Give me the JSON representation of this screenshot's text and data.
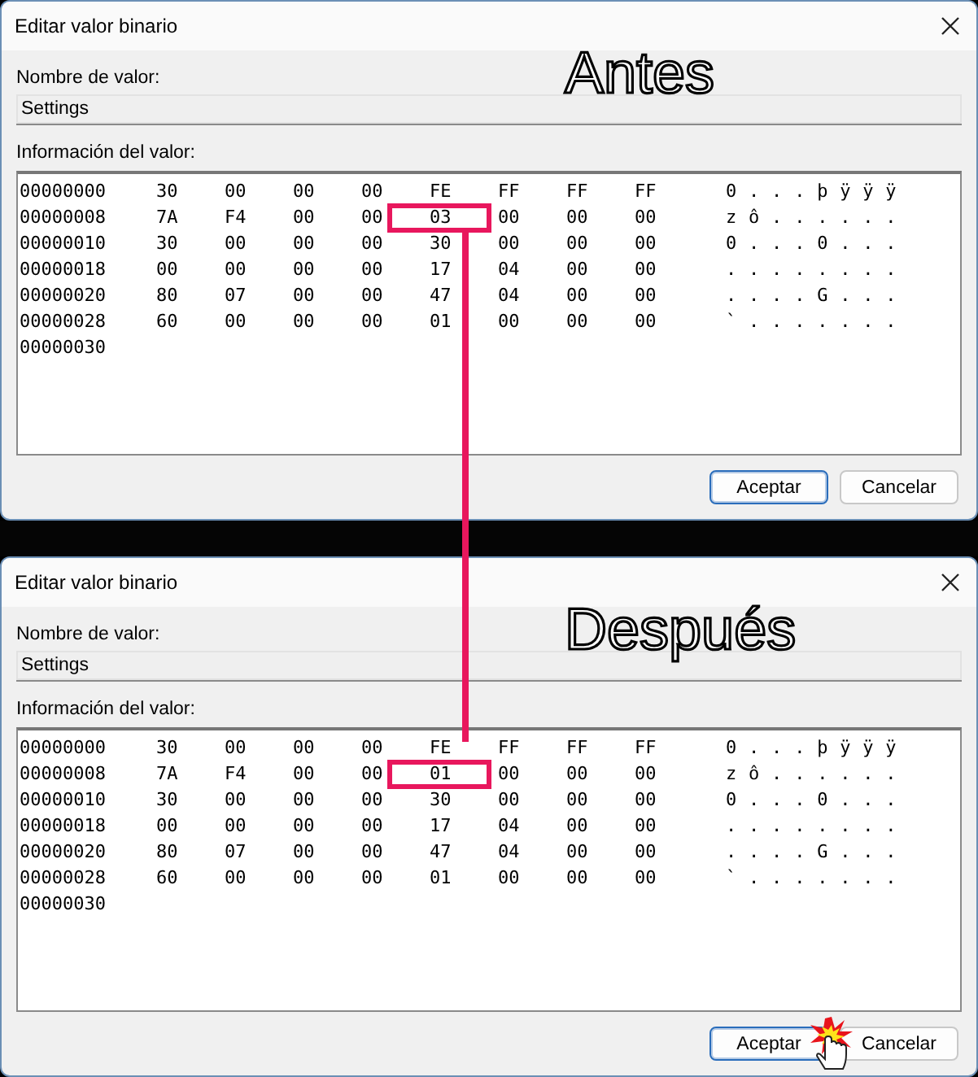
{
  "panels": [
    {
      "title": "Editar valor binario",
      "annotation": "Antes",
      "name_label": "Nombre de valor:",
      "name_value": "Settings",
      "data_label": "Información del valor:",
      "pointer": false,
      "rows": [
        {
          "address": "00000000",
          "bytes": [
            {
              "value": "30",
              "boxed": false
            },
            {
              "value": "00",
              "boxed": false
            },
            {
              "value": "00",
              "boxed": false
            },
            {
              "value": "00",
              "boxed": false
            },
            {
              "value": "FE",
              "boxed": false
            },
            {
              "value": "FF",
              "boxed": false
            },
            {
              "value": "FF",
              "boxed": false
            },
            {
              "value": "FF",
              "boxed": false
            }
          ],
          "ascii": "0...þÿÿÿ"
        },
        {
          "address": "00000008",
          "bytes": [
            {
              "value": "7A",
              "boxed": false
            },
            {
              "value": "F4",
              "boxed": false
            },
            {
              "value": "00",
              "boxed": false
            },
            {
              "value": "00",
              "boxed": false
            },
            {
              "value": "03",
              "boxed": true
            },
            {
              "value": "00",
              "boxed": false
            },
            {
              "value": "00",
              "boxed": false
            },
            {
              "value": "00",
              "boxed": false
            }
          ],
          "ascii": "zô......"
        },
        {
          "address": "00000010",
          "bytes": [
            {
              "value": "30",
              "boxed": false
            },
            {
              "value": "00",
              "boxed": false
            },
            {
              "value": "00",
              "boxed": false
            },
            {
              "value": "00",
              "boxed": false
            },
            {
              "value": "30",
              "boxed": false
            },
            {
              "value": "00",
              "boxed": false
            },
            {
              "value": "00",
              "boxed": false
            },
            {
              "value": "00",
              "boxed": false
            }
          ],
          "ascii": "0...0..."
        },
        {
          "address": "00000018",
          "bytes": [
            {
              "value": "00",
              "boxed": false
            },
            {
              "value": "00",
              "boxed": false
            },
            {
              "value": "00",
              "boxed": false
            },
            {
              "value": "00",
              "boxed": false
            },
            {
              "value": "17",
              "boxed": false
            },
            {
              "value": "04",
              "boxed": false
            },
            {
              "value": "00",
              "boxed": false
            },
            {
              "value": "00",
              "boxed": false
            }
          ],
          "ascii": "........"
        },
        {
          "address": "00000020",
          "bytes": [
            {
              "value": "80",
              "boxed": false
            },
            {
              "value": "07",
              "boxed": false
            },
            {
              "value": "00",
              "boxed": false
            },
            {
              "value": "00",
              "boxed": false
            },
            {
              "value": "47",
              "boxed": false
            },
            {
              "value": "04",
              "boxed": false
            },
            {
              "value": "00",
              "boxed": false
            },
            {
              "value": "00",
              "boxed": false
            }
          ],
          "ascii": "....G..."
        },
        {
          "address": "00000028",
          "bytes": [
            {
              "value": "60",
              "boxed": false
            },
            {
              "value": "00",
              "boxed": false
            },
            {
              "value": "00",
              "boxed": false
            },
            {
              "value": "00",
              "boxed": false
            },
            {
              "value": "01",
              "boxed": false
            },
            {
              "value": "00",
              "boxed": false
            },
            {
              "value": "00",
              "boxed": false
            },
            {
              "value": "00",
              "boxed": false
            }
          ],
          "ascii": "`......."
        }
      ],
      "last_address": "00000030",
      "buttons": [
        {
          "label": "Aceptar",
          "default": true
        },
        {
          "label": "Cancelar",
          "default": false
        }
      ]
    },
    {
      "title": "Editar valor binario",
      "annotation": "Después",
      "name_label": "Nombre de valor:",
      "name_value": "Settings",
      "data_label": "Información del valor:",
      "pointer": true,
      "rows": [
        {
          "address": "00000000",
          "bytes": [
            {
              "value": "30",
              "boxed": false
            },
            {
              "value": "00",
              "boxed": false
            },
            {
              "value": "00",
              "boxed": false
            },
            {
              "value": "00",
              "boxed": false
            },
            {
              "value": "FE",
              "boxed": false
            },
            {
              "value": "FF",
              "boxed": false
            },
            {
              "value": "FF",
              "boxed": false
            },
            {
              "value": "FF",
              "boxed": false
            }
          ],
          "ascii": "0...þÿÿÿ"
        },
        {
          "address": "00000008",
          "bytes": [
            {
              "value": "7A",
              "boxed": false
            },
            {
              "value": "F4",
              "boxed": false
            },
            {
              "value": "00",
              "boxed": false
            },
            {
              "value": "00",
              "boxed": false
            },
            {
              "value": "01",
              "boxed": true
            },
            {
              "value": "00",
              "boxed": false
            },
            {
              "value": "00",
              "boxed": false
            },
            {
              "value": "00",
              "boxed": false
            }
          ],
          "ascii": "zô......"
        },
        {
          "address": "00000010",
          "bytes": [
            {
              "value": "30",
              "boxed": false
            },
            {
              "value": "00",
              "boxed": false
            },
            {
              "value": "00",
              "boxed": false
            },
            {
              "value": "00",
              "boxed": false
            },
            {
              "value": "30",
              "boxed": false
            },
            {
              "value": "00",
              "boxed": false
            },
            {
              "value": "00",
              "boxed": false
            },
            {
              "value": "00",
              "boxed": false
            }
          ],
          "ascii": "0...0..."
        },
        {
          "address": "00000018",
          "bytes": [
            {
              "value": "00",
              "boxed": false
            },
            {
              "value": "00",
              "boxed": false
            },
            {
              "value": "00",
              "boxed": false
            },
            {
              "value": "00",
              "boxed": false
            },
            {
              "value": "17",
              "boxed": false
            },
            {
              "value": "04",
              "boxed": false
            },
            {
              "value": "00",
              "boxed": false
            },
            {
              "value": "00",
              "boxed": false
            }
          ],
          "ascii": "........"
        },
        {
          "address": "00000020",
          "bytes": [
            {
              "value": "80",
              "boxed": false
            },
            {
              "value": "07",
              "boxed": false
            },
            {
              "value": "00",
              "boxed": false
            },
            {
              "value": "00",
              "boxed": false
            },
            {
              "value": "47",
              "boxed": false
            },
            {
              "value": "04",
              "boxed": false
            },
            {
              "value": "00",
              "boxed": false
            },
            {
              "value": "00",
              "boxed": false
            }
          ],
          "ascii": "....G..."
        },
        {
          "address": "00000028",
          "bytes": [
            {
              "value": "60",
              "boxed": false
            },
            {
              "value": "00",
              "boxed": false
            },
            {
              "value": "00",
              "boxed": false
            },
            {
              "value": "00",
              "boxed": false
            },
            {
              "value": "01",
              "boxed": false
            },
            {
              "value": "00",
              "boxed": false
            },
            {
              "value": "00",
              "boxed": false
            },
            {
              "value": "00",
              "boxed": false
            }
          ],
          "ascii": "`......."
        }
      ],
      "last_address": "00000030",
      "buttons": [
        {
          "label": "Aceptar",
          "default": true
        },
        {
          "label": "Cancelar",
          "default": false
        }
      ]
    }
  ]
}
